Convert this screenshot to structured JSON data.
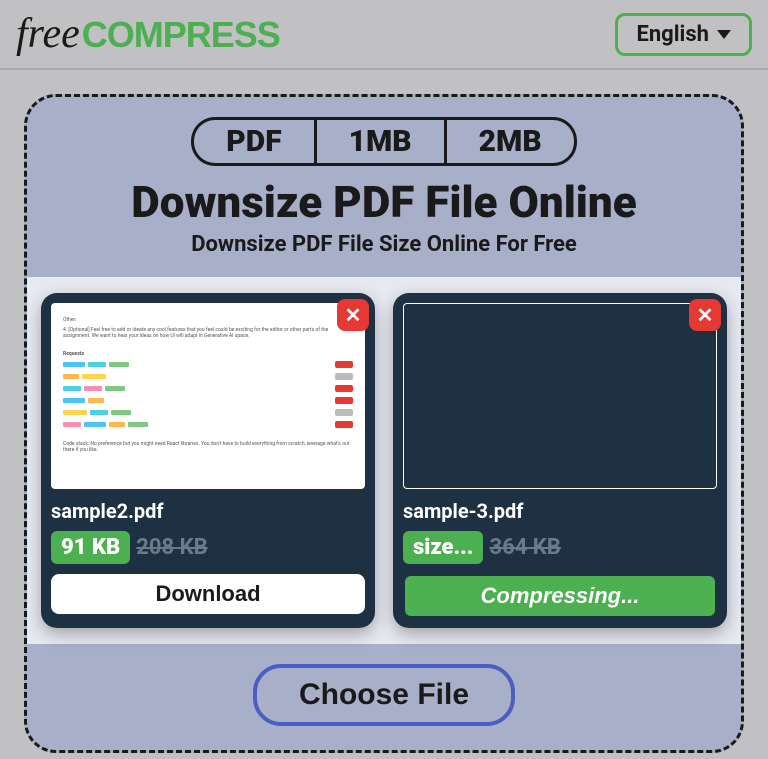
{
  "header": {
    "logo_free": "free",
    "logo_compress": "COMPRESS",
    "language": "English"
  },
  "tabs": {
    "items": [
      "PDF",
      "1MB",
      "2MB"
    ]
  },
  "title": "Downsize PDF File Online",
  "subtitle": "Downsize PDF File Size Online For Free",
  "files": [
    {
      "name": "sample2.pdf",
      "new_size": "91 KB",
      "old_size": "208 KB",
      "action": "Download"
    },
    {
      "name": "sample-3.pdf",
      "new_size": "size...",
      "old_size": "364 KB",
      "action": "Compressing..."
    }
  ],
  "choose_file": "Choose File"
}
